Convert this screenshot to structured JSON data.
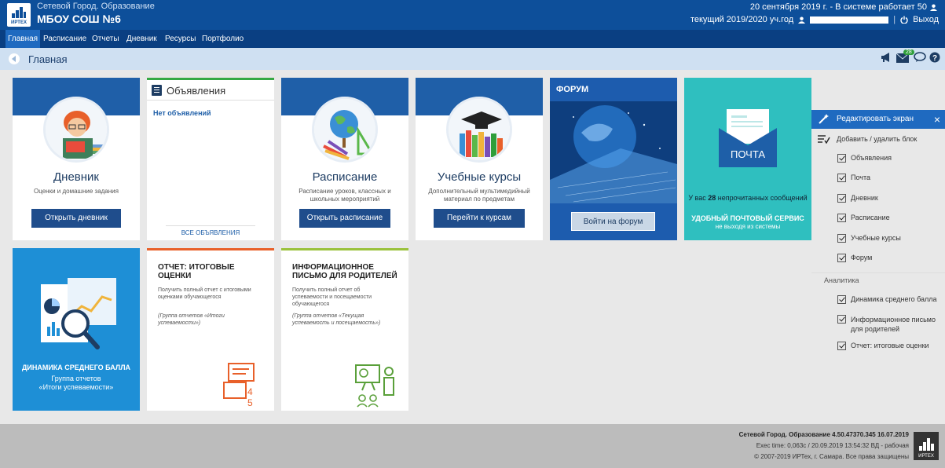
{
  "header": {
    "app_title": "Сетевой Город. Образование",
    "school": "МБОУ СОШ №6",
    "date_status": "20 сентября 2019 г. - В системе работает 50",
    "year": "текущий 2019/2020 уч.год",
    "separator": "|",
    "logout": "Выход"
  },
  "nav": [
    "Главная",
    "Расписание",
    "Отчеты",
    "Дневник",
    "Ресурсы",
    "Портфолио"
  ],
  "breadcrumb": {
    "title": "Главная",
    "mail_badge": "28"
  },
  "tiles": {
    "diary": {
      "title": "Дневник",
      "subtitle": "Оценки и домашние задания",
      "button": "Открыть дневник"
    },
    "announcements": {
      "title": "Объявления",
      "empty": "Нет объявлений",
      "all_link": "ВСЕ ОБЪЯВЛЕНИЯ"
    },
    "schedule": {
      "title": "Расписание",
      "subtitle": "Расписание уроков, классных и школьных мероприятий",
      "button": "Открыть расписание"
    },
    "courses": {
      "title": "Учебные курсы",
      "subtitle": "Дополнительный мультимедийный материал по предметам",
      "button": "Перейти к курсам"
    },
    "forum": {
      "title": "ФОРУМ",
      "button": "Войти на форум"
    },
    "mail": {
      "envelope": "ПОЧТА",
      "unread_prefix": "У вас",
      "unread_count": "28",
      "unread_suffix": "непрочитанных сообщений",
      "service": "УДОБНЫЙ ПОЧТОВЫЙ СЕРВИС",
      "service_sub": "не выходя из системы"
    },
    "avg": {
      "title": "ДИНАМИКА СРЕДНЕГО БАЛЛА",
      "line1": "Группа отчетов",
      "line2": "«Итоги успеваемости»"
    },
    "report_final": {
      "title": "ОТЧЕТ: ИТОГОВЫЕ ОЦЕНКИ",
      "desc": "Получить полный отчет с итоговыми оценками обучающегося",
      "group": "(Группа отчетов «Итоги успеваемости»)"
    },
    "report_parents": {
      "title": "ИНФОРМАЦИОННОЕ ПИСЬМО ДЛЯ РОДИТЕЛЕЙ",
      "desc": "Получить полный отчет об успеваемости и посещаемости обучающегося",
      "group": "(Группа отчетов «Текущая успеваемость и посещаемость»)"
    }
  },
  "side": {
    "header": "Редактировать экран",
    "add_remove": "Добавить / удалить блок",
    "items": [
      "Объявления",
      "Почта",
      "Дневник",
      "Расписание",
      "Учебные курсы",
      "Форум"
    ],
    "analytics_label": "Аналитика",
    "analytics": [
      "Динамика среднего балла",
      "Информационное письмо для родителей",
      "Отчет: итоговые оценки"
    ]
  },
  "footer": {
    "line1": "Сетевой Город. Образование  4.50.47370.345  16.07.2019",
    "line2": "Exec time: 0,063с / 20.09.2019 13:54:32  ВД - рабочая",
    "line3": "© 2007-2019 ИРТех, г. Самара. Все права защищены",
    "logo_text": "ИРТЕХ"
  },
  "logo_text": "ИРТЕХ",
  "colors": {
    "header": "#0d4f9a",
    "nav": "#0a3f82",
    "accent_green": "#35a845",
    "mail_tile": "#2fbfbf",
    "avg_tile": "#1e8fd6"
  }
}
